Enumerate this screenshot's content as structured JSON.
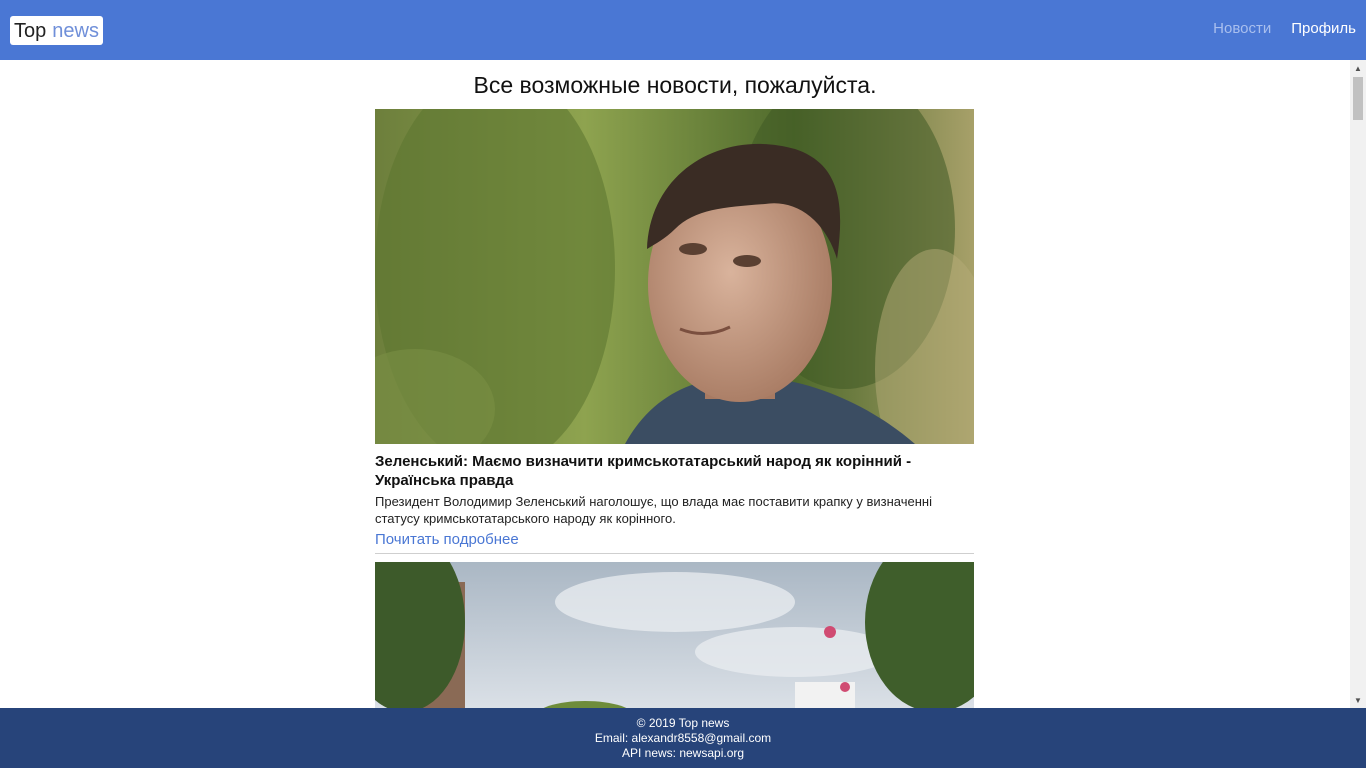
{
  "header": {
    "logo_word1": "Top",
    "logo_word2": "news",
    "nav": {
      "news_label": "Новости",
      "profile_label": "Профиль"
    }
  },
  "main": {
    "title": "Все возможные новости, пожалуйста.",
    "articles": [
      {
        "image_icon": "portrait-photo",
        "headline": "Зеленський: Маємо визначити кримськотатарський народ як корінний - Українська правда",
        "description": "Президент Володимир Зеленський наголошує, що влада має поставити крапку у визначенні статусу кримськотатарського народу як корінного.",
        "read_more": "Почитать подробнее"
      },
      {
        "image_icon": "building-sky-photo"
      }
    ]
  },
  "footer": {
    "copyright": "© 2019 Top news",
    "email": "Email: alexandr8558@gmail.com",
    "api": "API news: newsapi.org"
  },
  "colors": {
    "header_bg": "#4a77d4",
    "footer_bg": "#27447a",
    "link": "#4a77d4"
  }
}
